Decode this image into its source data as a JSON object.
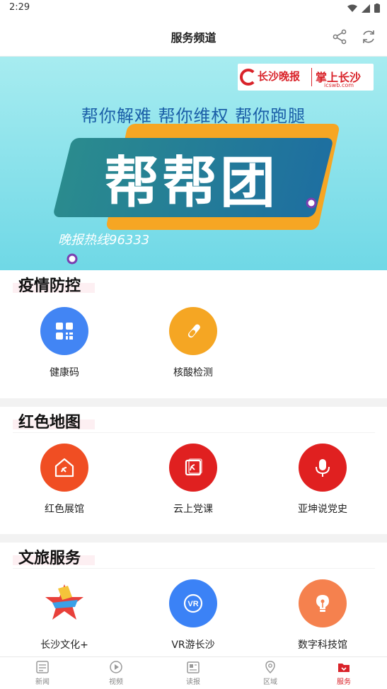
{
  "status_bar": {
    "time": "2:29"
  },
  "header": {
    "title": "服务频道"
  },
  "banner": {
    "logo_left": "长沙晚报",
    "logo_right": "掌上长沙",
    "logo_url": "icswb.com",
    "tagline": "帮你解难  帮你维权  帮你跑腿",
    "main_text": "帮帮团",
    "hotline": "晚报热线96333"
  },
  "sections": [
    {
      "title": "疫情防控",
      "items": [
        {
          "label": "健康码",
          "icon": "qr-code-icon",
          "color": "#4285f4"
        },
        {
          "label": "核酸检测",
          "icon": "test-tube-icon",
          "color": "#f5a623"
        }
      ]
    },
    {
      "title": "红色地图",
      "items": [
        {
          "label": "红色展馆",
          "icon": "museum-icon",
          "color": "#f04e23"
        },
        {
          "label": "云上党课",
          "icon": "party-book-icon",
          "color": "#e02020"
        },
        {
          "label": "亚坤说党史",
          "icon": "microphone-icon",
          "color": "#e02020"
        }
      ]
    },
    {
      "title": "文旅服务",
      "items": [
        {
          "label": "长沙文化+",
          "icon": "culture-star-icon",
          "color": "#e8403a"
        },
        {
          "label": "VR游长沙",
          "icon": "vr-icon",
          "color": "#3b82f6"
        },
        {
          "label": "数字科技馆",
          "icon": "lightbulb-icon",
          "color": "#f5814e"
        }
      ]
    }
  ],
  "bottom_nav": [
    {
      "label": "新闻",
      "icon": "news-icon"
    },
    {
      "label": "视频",
      "icon": "video-icon"
    },
    {
      "label": "读报",
      "icon": "newspaper-icon"
    },
    {
      "label": "区域",
      "icon": "location-icon"
    },
    {
      "label": "服务",
      "icon": "service-icon",
      "active": true
    }
  ],
  "colors": {
    "accent": "#d9232a",
    "divider": "#f2f2f2"
  }
}
